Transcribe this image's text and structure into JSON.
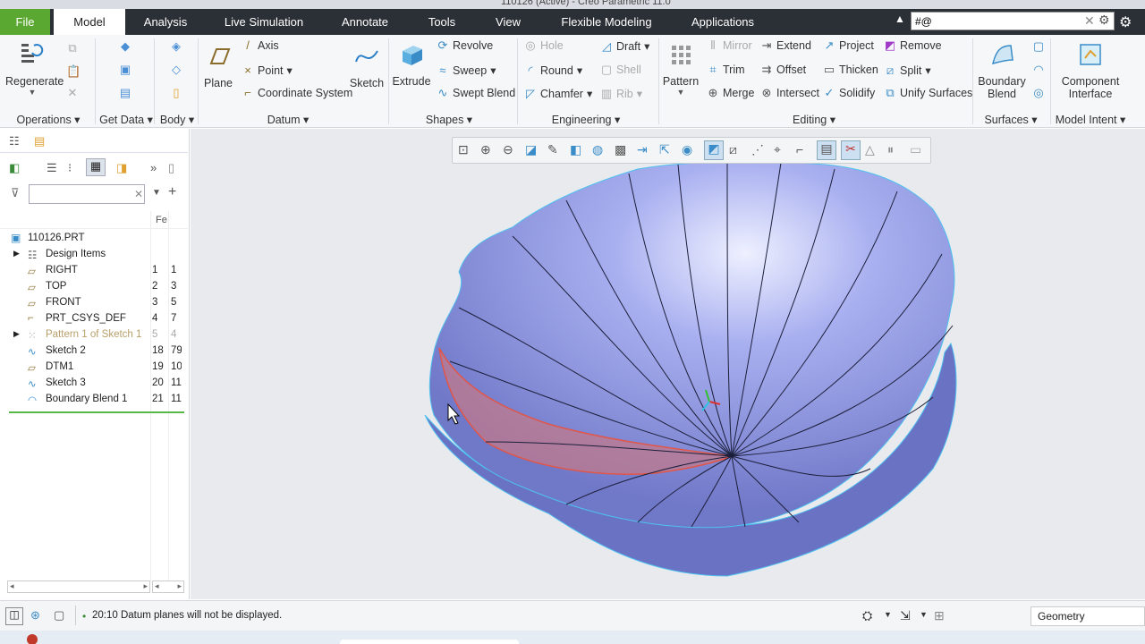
{
  "title_bar": {
    "app_title": "110126 (Active) - Creo Parametric 11.0"
  },
  "tabs": [
    {
      "label": "File"
    },
    {
      "label": "Model"
    },
    {
      "label": "Analysis"
    },
    {
      "label": "Live Simulation"
    },
    {
      "label": "Annotate"
    },
    {
      "label": "Tools"
    },
    {
      "label": "View"
    },
    {
      "label": "Flexible Modeling"
    },
    {
      "label": "Applications"
    }
  ],
  "search": {
    "value": "#@"
  },
  "ribbon": {
    "regenerate": "Regenerate",
    "plane": "Plane",
    "axis": "Axis",
    "point": "Point",
    "coordinate_system": "Coordinate System",
    "sketch": "Sketch",
    "extrude": "Extrude",
    "revolve": "Revolve",
    "sweep": "Sweep",
    "swept_blend": "Swept Blend",
    "hole": "Hole",
    "round": "Round",
    "chamfer": "Chamfer",
    "draft": "Draft",
    "shell": "Shell",
    "rib": "Rib",
    "pattern": "Pattern",
    "mirror": "Mirror",
    "trim": "Trim",
    "merge": "Merge",
    "extend": "Extend",
    "offset": "Offset",
    "intersect": "Intersect",
    "project": "Project",
    "thicken": "Thicken",
    "solidify": "Solidify",
    "remove": "Remove",
    "split": "Split",
    "unify_surfaces": "Unify Surfaces",
    "boundary_blend": "Boundary\nBlend",
    "component_interface": "Component\nInterface",
    "groups": {
      "operations": "Operations",
      "get_data": "Get Data",
      "body": "Body",
      "datum": "Datum",
      "shapes": "Shapes",
      "engineering": "Engineering",
      "editing": "Editing",
      "surfaces": "Surfaces",
      "model_intent": "Model Intent"
    }
  },
  "model_tree": {
    "column_header": "Fe",
    "root": "110126.PRT",
    "items": [
      {
        "label": "Design Items",
        "n1": "",
        "n2": ""
      },
      {
        "label": "RIGHT",
        "n1": "1",
        "n2": "1"
      },
      {
        "label": "TOP",
        "n1": "2",
        "n2": "3"
      },
      {
        "label": "FRONT",
        "n1": "3",
        "n2": "5"
      },
      {
        "label": "PRT_CSYS_DEF",
        "n1": "4",
        "n2": "7"
      },
      {
        "label": "Pattern 1 of Sketch 1",
        "n1": "5",
        "n2": "4"
      },
      {
        "label": "Sketch 2",
        "n1": "18",
        "n2": "79"
      },
      {
        "label": "DTM1",
        "n1": "19",
        "n2": "10"
      },
      {
        "label": "Sketch 3",
        "n1": "20",
        "n2": "11"
      },
      {
        "label": "Boundary Blend 1",
        "n1": "21",
        "n2": "11"
      }
    ]
  },
  "status": {
    "message": "20:10 Datum planes will not be displayed.",
    "filter": "Geometry"
  },
  "colors": {
    "tabbar": "#2b2f36",
    "file_tab": "#5aa832",
    "surface": "#8c94e0",
    "highlight": "#e0564a"
  }
}
